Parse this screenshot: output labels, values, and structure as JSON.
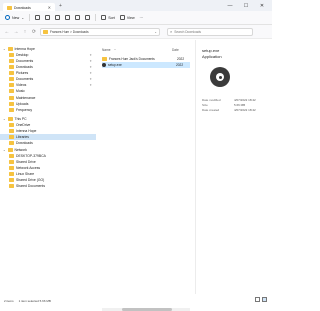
{
  "titlebar": {
    "tab_label": "Downloads",
    "tab_close": "✕",
    "new_tab": "+",
    "minimize": "—",
    "maximize": "☐",
    "close": "✕"
  },
  "toolbar": {
    "new_label": "New",
    "new_arrow": "⌄",
    "sort_label": "Sort",
    "view_label": "View",
    "more": "···"
  },
  "address": {
    "back": "←",
    "forward": "→",
    "up": "↑",
    "refresh": "⟳",
    "path": "Frances Hum > Downloads",
    "chevron": "⌄",
    "search_placeholder": "Search Downloads"
  },
  "sidebar": {
    "items": [
      {
        "label": "Intenna Hope",
        "expand": "⌄",
        "selected": false
      },
      {
        "label": "Desktop",
        "pin": "✦",
        "selected": false
      },
      {
        "label": "Documents",
        "pin": "✦",
        "selected": false
      },
      {
        "label": "Downloads",
        "pin": "✦",
        "selected": false
      },
      {
        "label": "Pictures",
        "pin": "✦",
        "selected": false
      },
      {
        "label": "Documents",
        "pin": "✦",
        "selected": false
      },
      {
        "label": "Videos",
        "pin": "✦",
        "selected": false
      },
      {
        "label": "Music",
        "selected": false
      },
      {
        "label": "Maintenance",
        "selected": false
      },
      {
        "label": "Uploads",
        "selected": false
      },
      {
        "label": "Frequency",
        "selected": false
      },
      {
        "label": "This PC",
        "expand": "⌄",
        "selected": false
      },
      {
        "label": "OneDrive",
        "selected": false
      },
      {
        "label": "Intenna Hope",
        "selected": false
      },
      {
        "label": "Libraries",
        "selected": true
      },
      {
        "label": "Downloads",
        "selected": false
      },
      {
        "label": "Network",
        "expand": "⌄",
        "selected": false
      },
      {
        "label": "DESKTOP-379BCA",
        "selected": false
      },
      {
        "label": "Shared Drive",
        "selected": false
      },
      {
        "label": "Network Access",
        "selected": false
      },
      {
        "label": "Linux Share",
        "selected": false
      },
      {
        "label": "Shared Drive (GO)",
        "selected": false
      },
      {
        "label": "Shared Documents",
        "selected": false
      }
    ]
  },
  "filelist": {
    "col_name": "Name",
    "col_date": "Date",
    "sort_arrow": "^",
    "rows": [
      {
        "name": "Frances Hum Jack's Documents",
        "date": "2022",
        "selected": false
      },
      {
        "name": "setup.exe",
        "date": "2022",
        "selected": true
      }
    ]
  },
  "details": {
    "title_line1": "setup.exe",
    "title_line2": "Application",
    "rows": [
      {
        "key": "Date modified",
        "value": "4/07/2022 18:42"
      },
      {
        "key": "Size",
        "value": "5.66 MB"
      },
      {
        "key": "Date created",
        "value": "4/07/2022 18:42"
      }
    ]
  },
  "status": {
    "items": "2 items",
    "selected": "1 item selected 5.66 MB"
  },
  "colors": {
    "accent": "#0067c0",
    "folder": "#f6c340",
    "selected_bg": "#cce8ff"
  }
}
